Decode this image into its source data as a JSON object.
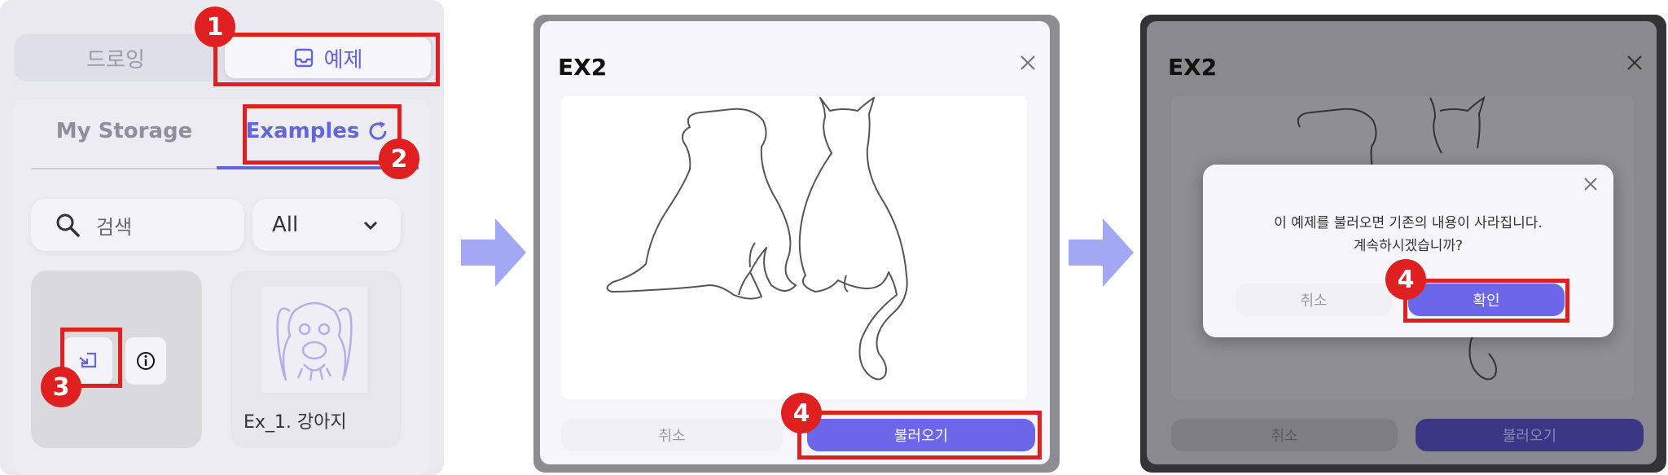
{
  "panel1": {
    "segment": {
      "drawing": "드로잉",
      "examples": "예제"
    },
    "tabs": {
      "my_storage": "My Storage",
      "examples": "Examples"
    },
    "search": {
      "placeholder": "검색"
    },
    "filter": {
      "selected": "All"
    },
    "cards": [
      {
        "label": ""
      },
      {
        "label": "Ex_1. 강아지"
      }
    ]
  },
  "dialog": {
    "title": "EX2",
    "cancel": "취소",
    "load": "불러오기"
  },
  "confirm": {
    "line1": "이 예제를 불러오면 기존의 내용이 사라집니다.",
    "line2": "계속하시겠습니까?",
    "cancel": "취소",
    "ok": "확인"
  },
  "badges": {
    "b1": "1",
    "b2": "2",
    "b3": "3",
    "b4": "4"
  },
  "colors": {
    "accent": "#6c66ea",
    "highlight": "#e02020",
    "arrow": "#a3a8f5"
  }
}
